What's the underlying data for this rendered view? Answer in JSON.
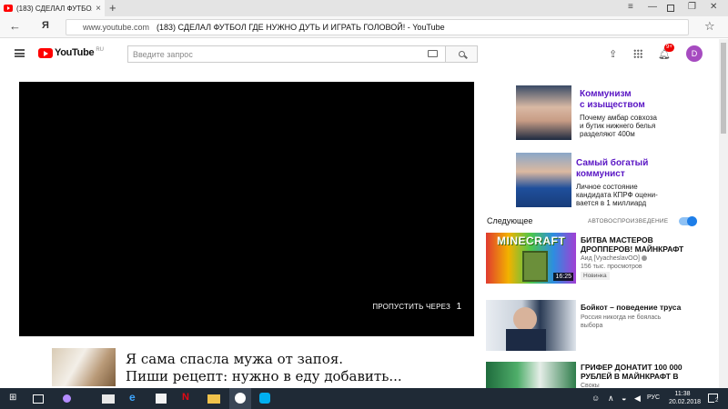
{
  "browser": {
    "tab_title": "(183) СДЕЛАЛ ФУТБОЛ Г",
    "tab_close": "×",
    "new_tab": "+",
    "url_host": "www.youtube.com",
    "page_title": "(183) СДЕЛАЛ ФУТБОЛ ГДЕ НУЖНО ДУТЬ И ИГРАТЬ ГОЛОВОЙ! - YouTube",
    "yandex_label": "Я"
  },
  "youtube": {
    "logo_text": "YouTube",
    "logo_region": "RU",
    "search_placeholder": "Введите запрос",
    "notification_count": "9+",
    "avatar_letter": "D"
  },
  "player": {
    "skip_label": "ПРОПУСТИТЬ ЧЕРЕЗ",
    "skip_seconds": "1"
  },
  "ad_below": {
    "line1": "Я сама спасла мужа от запоя.",
    "line2": "Пиши рецепт: нужно в еду добавить..."
  },
  "sidebar_ads": [
    {
      "title_line1": "Коммунизм",
      "title_line2": "с изыществом",
      "desc_line1": "Почему амбар совхоза",
      "desc_line2": "и бутик нижнего белья",
      "desc_line3": "разделяют 400м"
    },
    {
      "title_line1": "Самый богатый",
      "title_line2": "коммунист",
      "desc_line1": "Личное состояние",
      "desc_line2": "кандидата КПРФ оцени-",
      "desc_line3": "вается в 1 миллиард"
    }
  ],
  "up_next": {
    "heading": "Следующее",
    "autoplay_label": "АВТОВОСПРОИЗВЕДЕНИЕ",
    "autoplay_on": true
  },
  "videos": [
    {
      "title_line1": "БИТВА МАСТЕРОВ",
      "title_line2": "ДРОППЕРОВ! МАЙНКРАФТ",
      "channel": "Аид [VyacheslavOO]",
      "views": "156 тыс. просмотров",
      "badge": "Новинка",
      "duration": "16:25",
      "thumb_text": "MINECRAFT"
    },
    {
      "title_line1": "Бойкот – поведение труса",
      "meta_line1": "Россия никогда не боялась",
      "meta_line2": "выбора"
    },
    {
      "title_line1": "ГРИФЕР ДОНАТИТ 100 000",
      "title_line2": "РУБЛЕЙ В МАЙНКРАФТ В",
      "channel": "Свокы"
    }
  ],
  "taskbar": {
    "language": "РУС",
    "time": "11:38",
    "date": "20.02.2018",
    "notification_count": "2"
  },
  "colors": {
    "yt_red": "#ff0000",
    "ad_title": "#5a16c4",
    "toggle_blue": "#1e7ee8",
    "taskbar": "#1f2a36",
    "avatar": "#a64bc0"
  }
}
